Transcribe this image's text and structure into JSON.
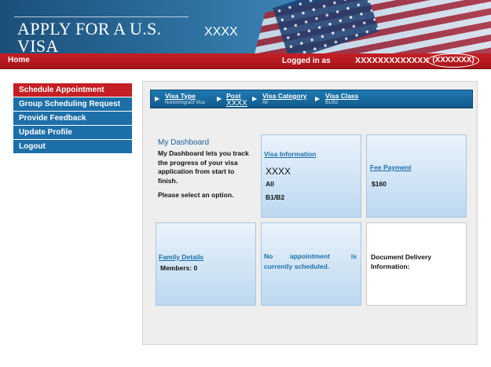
{
  "banner": {
    "title": "APPLY FOR A U.S. VISA",
    "redacted": "XXXX"
  },
  "nav": {
    "home": "Home",
    "logged_in_label": "Logged in as",
    "user_name": "XXXXXXXXXXXXX",
    "user_code": "(XXXXXXX)"
  },
  "menu": {
    "items": [
      {
        "label": "Schedule Appointment"
      },
      {
        "label": "Group Scheduling Request"
      },
      {
        "label": "Provide Feedback"
      },
      {
        "label": "Update Profile"
      },
      {
        "label": "Logout"
      }
    ]
  },
  "steps": [
    {
      "label": "Visa Type",
      "sub": "Nonimmigrant Visa"
    },
    {
      "label": "Post",
      "sub": "XXXX"
    },
    {
      "label": "Visa Category",
      "sub": "All"
    },
    {
      "label": "Visa Class",
      "sub": "B1/B2"
    }
  ],
  "dashboard": {
    "title": "My Dashboard",
    "description": "My Dashboard lets you track the progress of your visa application from start to finish.",
    "option_text": "Please select an option."
  },
  "cards": {
    "visa_info": {
      "link": "Visa Information",
      "post": "XXXX",
      "category": "All",
      "class": "B1/B2"
    },
    "fee": {
      "link": "Fee Payment",
      "amount": "$160"
    },
    "family": {
      "link": "Family Details",
      "members": "Members: 0"
    },
    "appointment": {
      "line1_a": "No",
      "line1_b": "appointment",
      "line1_c": "is",
      "line2": "currently scheduled."
    },
    "delivery": {
      "line1": "Document Delivery",
      "line2": "Information:"
    }
  },
  "colors": {
    "nav_red": "#c41f24",
    "menu_blue": "#1d6fa8",
    "link_blue": "#1d6fa8"
  }
}
